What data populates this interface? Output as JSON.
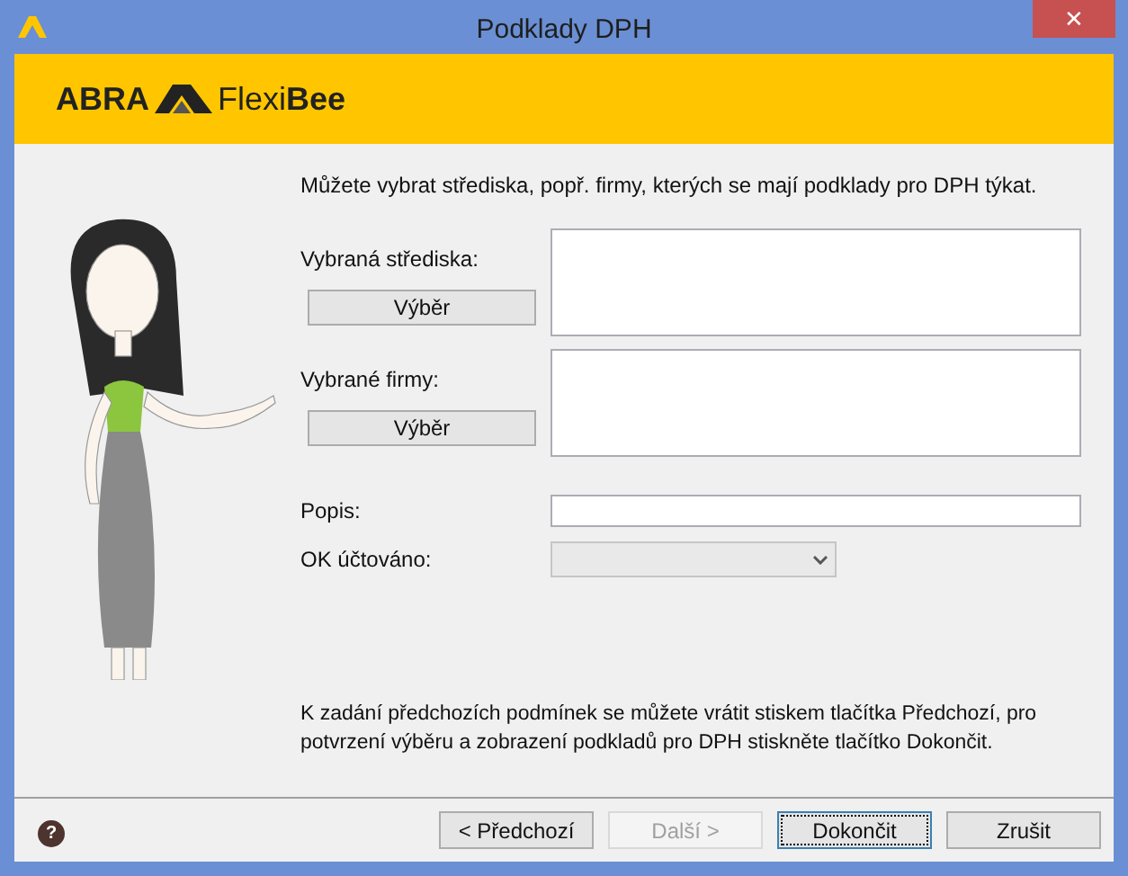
{
  "window": {
    "title": "Podklady DPH",
    "close": "✕"
  },
  "banner": {
    "logo_left": "ABRA",
    "logo_light": "Flexi",
    "logo_bold": "Bee"
  },
  "intro": "Můžete vybrat střediska, popř. firmy, kterých se mají podklady pro DPH týkat.",
  "fields": [
    {
      "kind": "list",
      "label": "Vybraná střediska:",
      "button": "Výběr"
    },
    {
      "kind": "list",
      "label": "Vybrané firmy:",
      "button": "Výběr"
    },
    {
      "kind": "text",
      "label": "Popis:"
    },
    {
      "kind": "select",
      "label": "OK účtováno:"
    }
  ],
  "hint": "K zadání předchozích podmínek se můžete vrátit stiskem tlačítka Předchozí, pro potvrzení výběru a zobrazení podkladů pro DPH stiskněte tlačítko Dokončit.",
  "help": "?",
  "buttons": [
    {
      "label": "< Předchozí",
      "disabled": false,
      "focused": false
    },
    {
      "label": "Další >",
      "disabled": true,
      "focused": false
    },
    {
      "label": "Dokončit",
      "disabled": false,
      "focused": true
    },
    {
      "label": "Zrušit",
      "disabled": false,
      "focused": false
    }
  ]
}
